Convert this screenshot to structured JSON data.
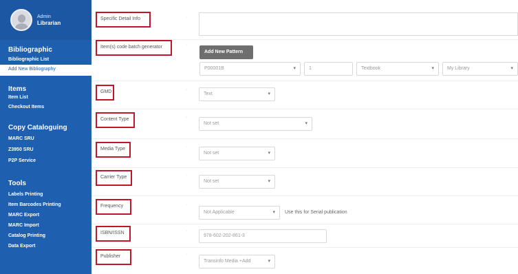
{
  "user": {
    "role": "Admin",
    "name": "Librarian"
  },
  "sidebar": {
    "bibliographic": {
      "title": "Bibliographic",
      "links": [
        "Bibliographic List"
      ],
      "active": "Add New Bibliography"
    },
    "items": {
      "title": "Items",
      "links": [
        "Item List",
        "Checkout Items"
      ]
    },
    "copy_cataloguing": {
      "title": "Copy Cataloguing",
      "links": [
        "MARC SRU",
        "Z3950 SRU",
        "P2P Service"
      ]
    },
    "tools": {
      "title": "Tools",
      "links": [
        "Labels Printing",
        "Item Barcodes Printing",
        "MARC Export",
        "MARC Import",
        "Catalog Printing",
        "Data Export"
      ]
    }
  },
  "form": {
    "specific_detail": {
      "label": "Specific Detail Info"
    },
    "item_code": {
      "label": "Item(s) code batch generator",
      "button": "Add New Pattern",
      "pattern_value": "P00001B",
      "total_value": "1",
      "collection_value": "Textbook",
      "location_value": "My Library"
    },
    "gmd": {
      "label": "GMD",
      "value": "Text"
    },
    "content_type": {
      "label": "Content Type",
      "value": "Not set"
    },
    "media_type": {
      "label": "Media Type",
      "value": "Not set"
    },
    "carrier_type": {
      "label": "Carrier Type",
      "value": "Not set"
    },
    "frequency": {
      "label": "Frequency",
      "value": "Not Applicable",
      "help": "Use this for Serial publication"
    },
    "isbn": {
      "label": "ISBN/ISSN",
      "value": "978-602-202-861-3"
    },
    "publisher": {
      "label": "Publisher",
      "value": "Transinfo Media +Add"
    }
  },
  "icons": {
    "caret": "chevron-down-icon",
    "avatar": "user-avatar-icon"
  }
}
